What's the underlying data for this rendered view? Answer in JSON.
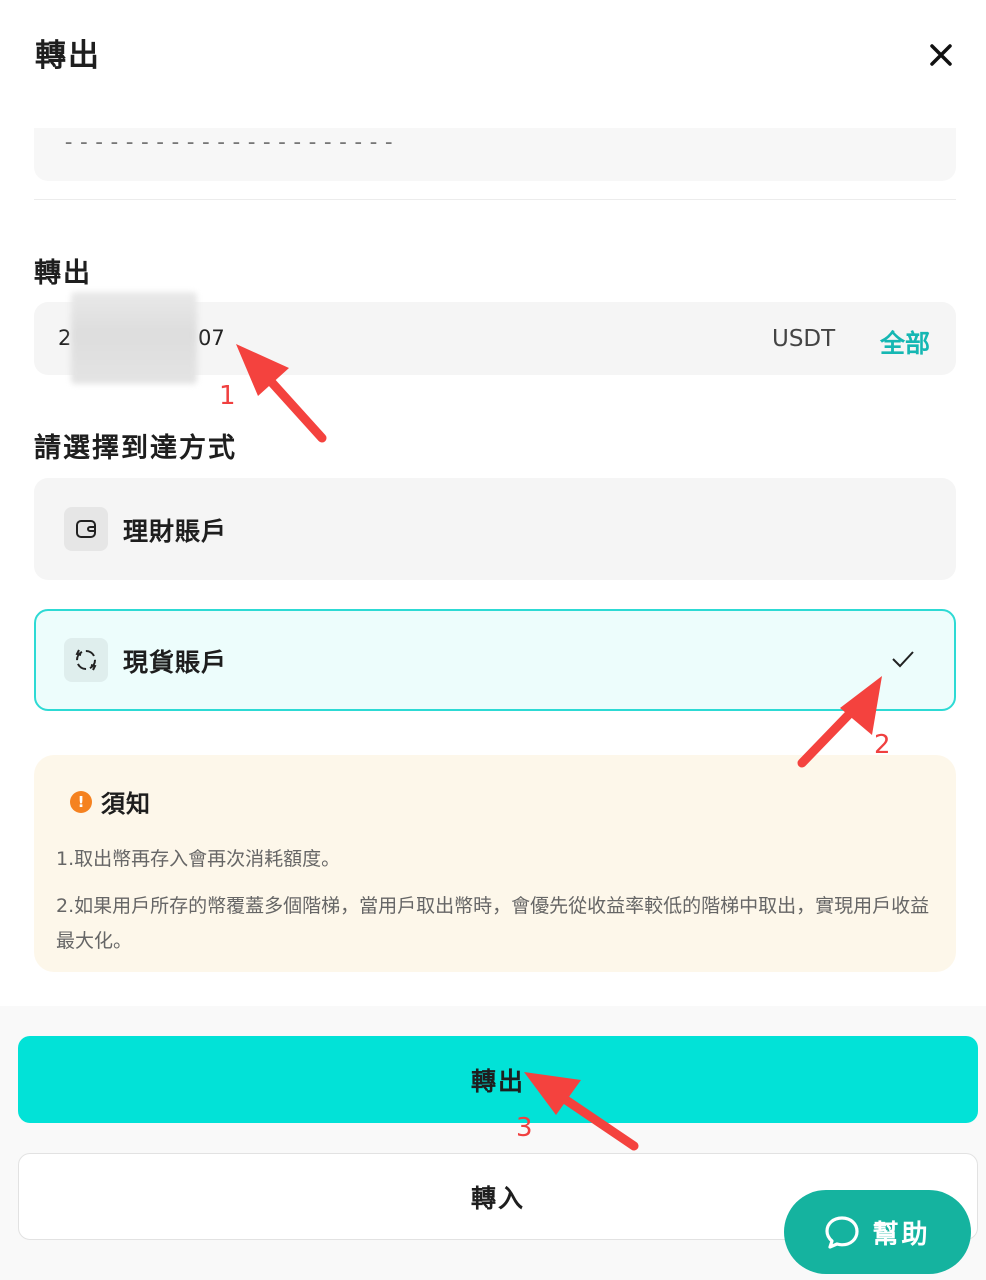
{
  "header": {
    "title": "轉出",
    "close_icon": "close-icon"
  },
  "top_card": {
    "dashes": "----------------------"
  },
  "transfer": {
    "label": "轉出",
    "amount_prefix": "2",
    "amount_suffix": "07",
    "unit": "USDT",
    "all_label": "全部"
  },
  "arrival": {
    "label": "請選擇到達方式",
    "options": [
      {
        "label": "理財賬戶",
        "icon": "wallet-icon",
        "selected": false
      },
      {
        "label": "現貨賬戶",
        "icon": "cycle-icon",
        "selected": true
      }
    ]
  },
  "notice": {
    "title": "須知",
    "icon_symbol": "!",
    "items": [
      "1.取出幣再存入會再次消耗額度。",
      "2.如果用戶所存的幣覆蓋多個階梯，當用戶取出幣時，會優先從收益率較低的階梯中取出，實現用戶收益最大化。"
    ]
  },
  "buttons": {
    "transfer_out": "轉出",
    "transfer_in": "轉入"
  },
  "help": {
    "label": "幫助"
  },
  "annotations": {
    "a1": "1",
    "a2": "2",
    "a3": "3"
  },
  "colors": {
    "accent": "#02e2d7",
    "link": "#15b7b3",
    "selected_border": "#2ddad4",
    "help_bg": "#15b39f",
    "warning": "#f58220",
    "annotation": "#f04040"
  }
}
